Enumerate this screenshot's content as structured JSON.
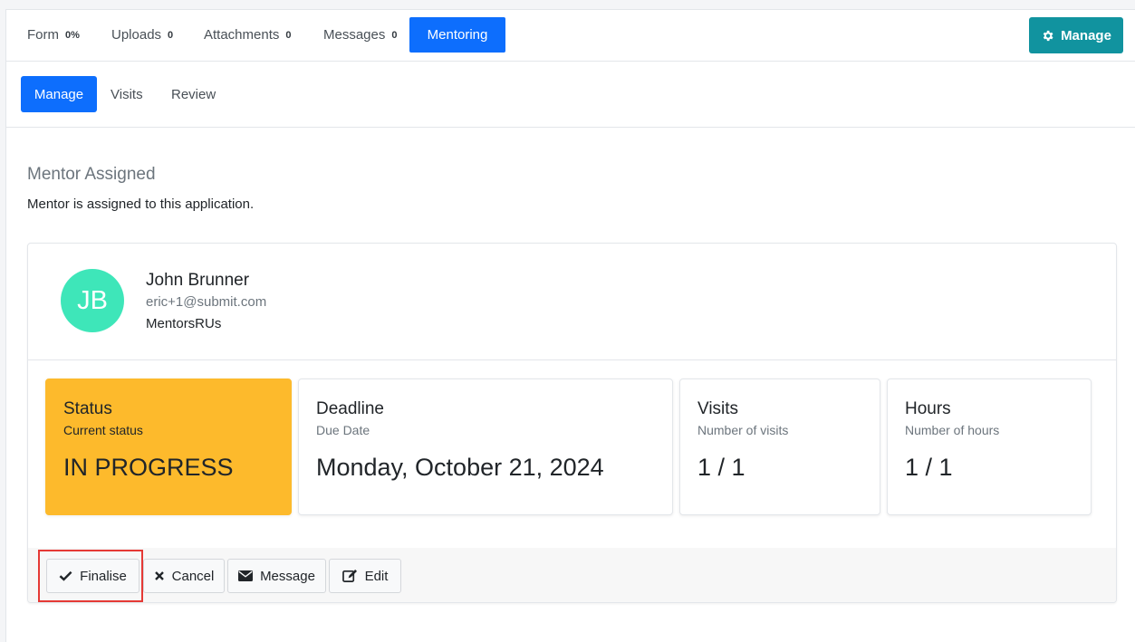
{
  "top_tabs": [
    {
      "label": "Form",
      "badge": "0%"
    },
    {
      "label": "Uploads",
      "badge": "0"
    },
    {
      "label": "Attachments",
      "badge": "0"
    },
    {
      "label": "Messages",
      "badge": "0"
    },
    {
      "label": "Mentoring",
      "active": true
    }
  ],
  "manage_top_label": "Manage",
  "sub_tabs": [
    {
      "label": "Manage",
      "active": true
    },
    {
      "label": "Visits"
    },
    {
      "label": "Review"
    }
  ],
  "section": {
    "title": "Mentor Assigned",
    "description": "Mentor is assigned to this application."
  },
  "mentor": {
    "initials": "JB",
    "name": "John Brunner",
    "email": "eric+1@submit.com",
    "org": "MentorsRUs"
  },
  "stats": [
    {
      "title": "Status",
      "subtitle": "Current status",
      "value": "IN PROGRESS"
    },
    {
      "title": "Deadline",
      "subtitle": "Due Date",
      "value": "Monday, October 21, 2024"
    },
    {
      "title": "Visits",
      "subtitle": "Number of visits",
      "value": "1 / 1"
    },
    {
      "title": "Hours",
      "subtitle": "Number of hours",
      "value": "1 / 1"
    }
  ],
  "actions": {
    "finalise": "Finalise",
    "cancel": "Cancel",
    "message": "Message",
    "edit": "Edit"
  },
  "colors": {
    "primary": "#0d6efd",
    "teal": "#11939f",
    "status_warning": "#fdba2c",
    "avatar": "#3ee6b9",
    "highlight": "#e53935"
  }
}
